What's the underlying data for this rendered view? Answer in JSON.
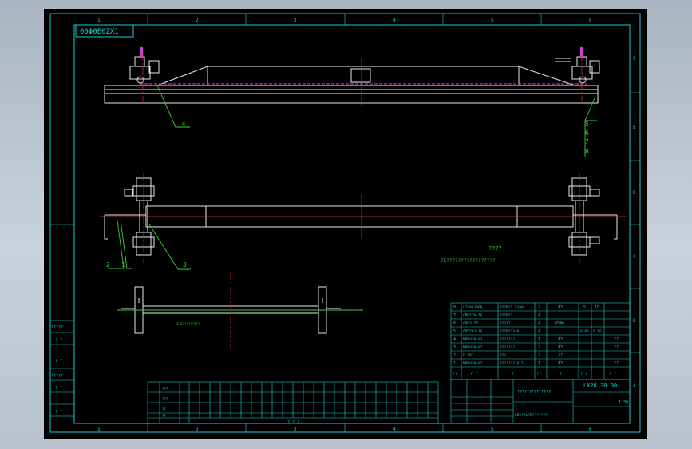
{
  "drawing": {
    "code_box": "00Φ0Ε0ZX1",
    "col_numbers": [
      "1",
      "2",
      "3",
      "4",
      "5",
      "6"
    ],
    "row_letters": [
      "A",
      "B",
      "C",
      "D",
      "E",
      "F"
    ],
    "balloons": [
      "4",
      "5",
      "6",
      "7",
      "8",
      "2",
      "1",
      "3"
    ],
    "note_center": "????",
    "note_line": "7Σ?????????????????",
    "shaft_note": "?5.5??????3??"
  },
  "left_table": {
    "rows": [
      "?????",
      "? ?",
      "? ?",
      "?????",
      "? ?",
      "? ?"
    ]
  },
  "parts_list": {
    "rows": [
      {
        "no": "8",
        "code": "L7?8L3000",
        "name": "???M?1.5?00",
        "qty": "2",
        "mat": "A3",
        "w1": "5",
        "w2": "10"
      },
      {
        "no": "7",
        "code": "GB6170-76",
        "name": "???M12",
        "qty": "4",
        "mat": "",
        "w1": "",
        "w2": ""
      },
      {
        "no": "6",
        "code": "GB93-76",
        "name": "???12",
        "qty": "4",
        "mat": "65Mn",
        "w1": "",
        "w2": ""
      },
      {
        "no": "5",
        "code": "GB5782-76",
        "name": "???M12?40",
        "qty": "4",
        "mat": "",
        "w1": "0.06",
        "w2": "0.16"
      },
      {
        "no": "4",
        "code": "MRDH20-03",
        "name": "???????",
        "qty": "1",
        "mat": "A3",
        "w1": "",
        "w2": "??"
      },
      {
        "no": "3",
        "code": "MRDH20-02",
        "name": "???????",
        "qty": "2",
        "mat": "A3",
        "w1": "",
        "w2": "??"
      },
      {
        "no": "2",
        "code": "D-182",
        "name": "???",
        "qty": "2",
        "mat": "??",
        "w1": "",
        "w2": ""
      },
      {
        "no": "1",
        "code": "MRDH20-01",
        "name": "???????10.5",
        "qty": "1",
        "mat": "A3",
        "w1": "",
        "w2": "??"
      }
    ],
    "header": [
      "??",
      "? ?",
      "? ?",
      "??",
      "? ?",
      "? ?",
      "? ?"
    ]
  },
  "title_block": {
    "company": "LX?8 30 00",
    "title1": "??????????????",
    "title2": "LDΦ??L?5???????",
    "scale": "1:30"
  },
  "bottom_table": {
    "footer": "? ? ?",
    "rows": [
      "???",
      "???",
      "??",
      "??"
    ]
  }
}
